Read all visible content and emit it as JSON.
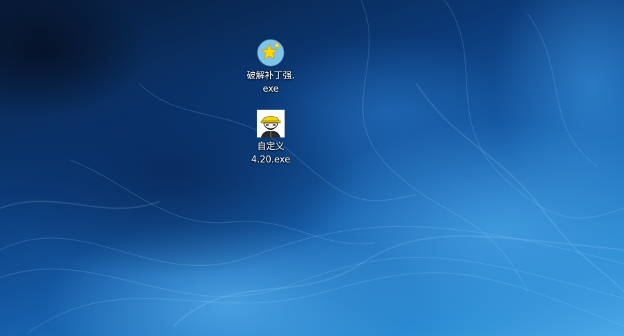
{
  "desktop": {
    "background": {
      "colors": [
        "#071a36",
        "#0b3a78",
        "#1660ac",
        "#2a8ad2",
        "#4aa9e6"
      ]
    },
    "icons": [
      {
        "label": "破解补丁强.\nexe",
        "icon": "star-badge-icon",
        "colors": {
          "circle": "#7fc4e8",
          "star": "#ffd600"
        }
      },
      {
        "label": "自定义\n4.20.exe",
        "icon": "hardhat-man-icon",
        "colors": {
          "helmet": "#f2d21a",
          "background": "#ffffff"
        }
      }
    ]
  }
}
